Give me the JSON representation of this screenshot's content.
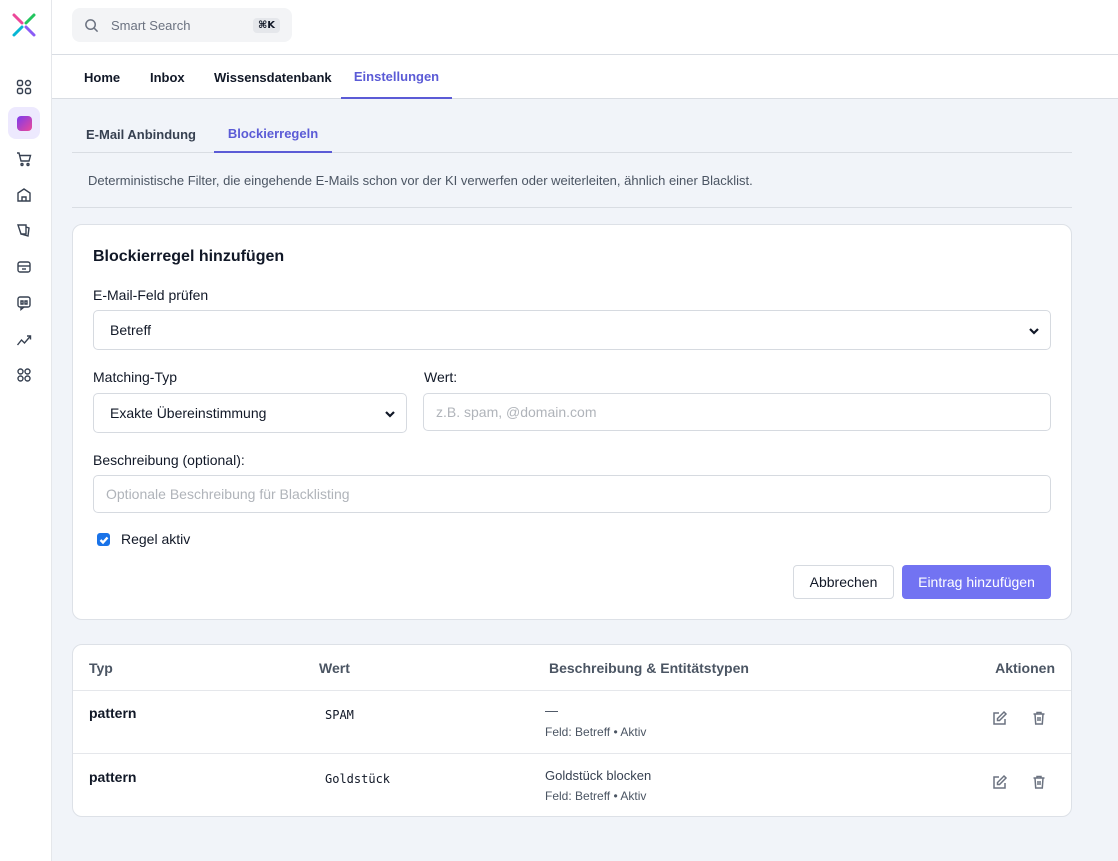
{
  "search": {
    "placeholder": "Smart Search",
    "shortcut": "⌘K"
  },
  "nav": {
    "tabs": [
      "Home",
      "Inbox",
      "Wissensdatenbank",
      "Einstellungen"
    ],
    "active": "Einstellungen"
  },
  "subtabs": {
    "items": [
      "E-Mail Anbindung",
      "Blockierregeln"
    ],
    "active": "Blockierregeln"
  },
  "description": "Deterministische Filter, die eingehende E-Mails schon vor der KI verwerfen oder weiterleiten, ähnlich einer Blacklist.",
  "form": {
    "title": "Blockierregel hinzufügen",
    "field_label": "E-Mail-Feld prüfen",
    "field_value": "Betreff",
    "matching_label": "Matching-Typ",
    "matching_value": "Exakte Übereinstimmung",
    "value_label": "Wert:",
    "value_placeholder": "z.B. spam, @domain.com",
    "desc_label": "Beschreibung (optional):",
    "desc_placeholder": "Optionale Beschreibung für Blacklisting",
    "active_label": "Regel aktiv",
    "active_checked": true,
    "cancel_label": "Abbrechen",
    "submit_label": "Eintrag hinzufügen"
  },
  "table": {
    "headers": [
      "Typ",
      "Wert",
      "Beschreibung & Entitätstypen",
      "Aktionen"
    ],
    "rows": [
      {
        "type": "pattern",
        "value": "SPAM",
        "description": "—",
        "meta": "Feld: Betreff • Aktiv"
      },
      {
        "type": "pattern",
        "value": "Goldstück",
        "description": "Goldstück blocken",
        "meta": "Feld: Betreff • Aktiv"
      }
    ]
  },
  "colors": {
    "accent": "#5b5bd6",
    "primary_button": "#7273f2",
    "checkbox": "#1a73e8"
  },
  "icons": [
    "logo-icon",
    "grid-icon",
    "sparkle-icon",
    "cart-icon",
    "store-icon",
    "tag-icon",
    "inbox-icon",
    "chat-icon",
    "chart-icon",
    "apps-icon",
    "search-icon",
    "chevron-down-icon",
    "edit-icon",
    "trash-icon"
  ]
}
